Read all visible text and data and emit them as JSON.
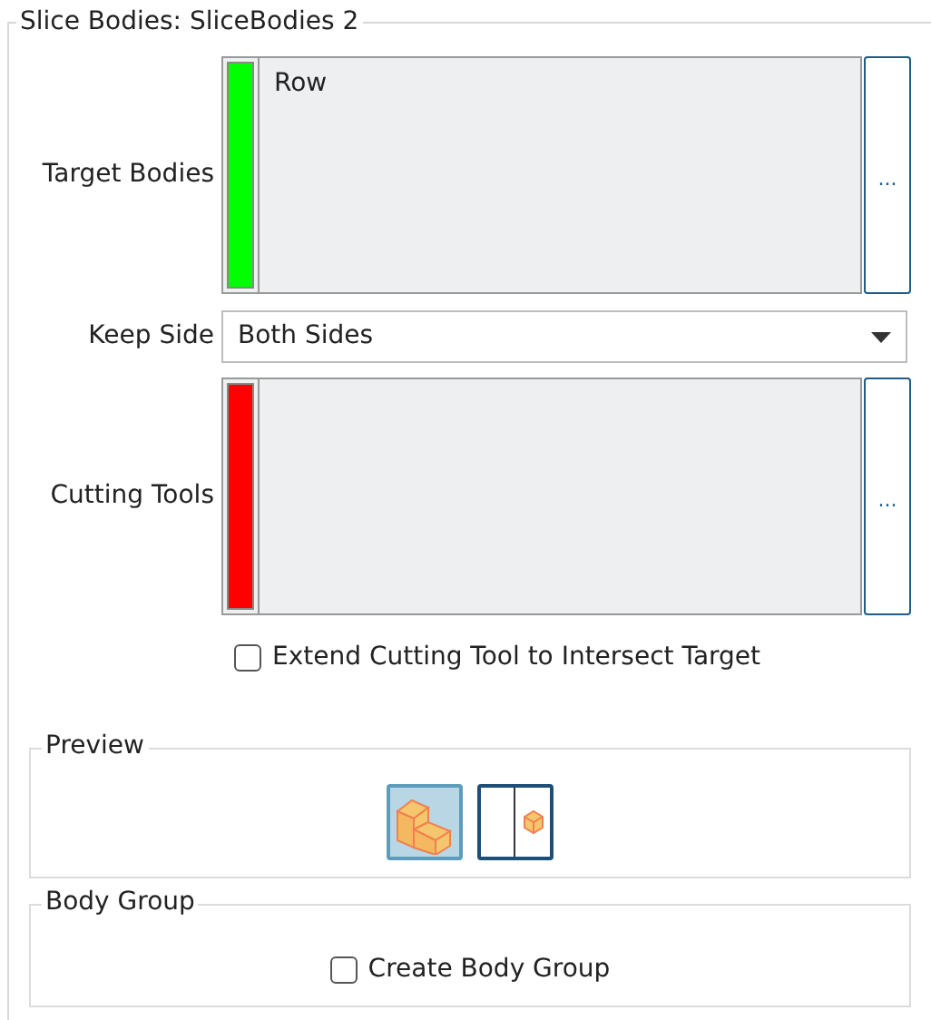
{
  "group": {
    "title": "Slice Bodies: SliceBodies 2"
  },
  "selectors": [
    {
      "label": "Target Bodies",
      "color": "#00ff00",
      "items": [
        "Row"
      ],
      "button": "..."
    },
    {
      "label": "Cutting Tools",
      "color": "#ff0000",
      "button": "..."
    }
  ],
  "keep_side": {
    "label": "Keep Side",
    "value": "Both Sides"
  },
  "extend_option": {
    "label": "Extend Cutting Tool to Intersect Target",
    "checked": false
  },
  "preview": {
    "title": "Preview",
    "buttons": [
      {
        "kind": "solid",
        "selected": true
      },
      {
        "kind": "split",
        "selected": false
      }
    ]
  },
  "body_group": {
    "title": "Body Group",
    "checkbox": {
      "label": "Create Body Group",
      "checked": false
    }
  }
}
